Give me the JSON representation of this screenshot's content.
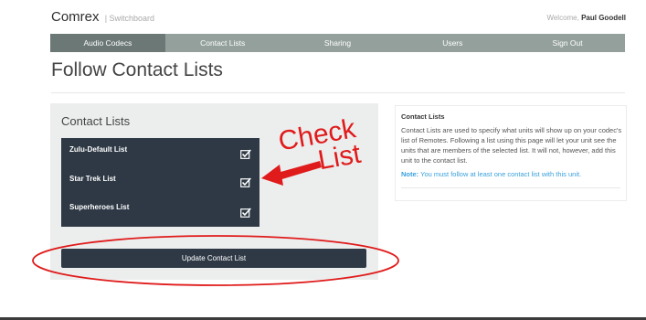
{
  "header": {
    "brand": "Comrex",
    "brand_sub": "| Switchboard",
    "welcome_prefix": "Welcome,",
    "user_name": "Paul Goodell"
  },
  "nav": {
    "tabs": [
      {
        "label": "Audio Codecs"
      },
      {
        "label": "Contact Lists"
      },
      {
        "label": "Sharing"
      },
      {
        "label": "Users"
      },
      {
        "label": "Sign Out"
      }
    ]
  },
  "page": {
    "title": "Follow Contact Lists"
  },
  "contact_panel": {
    "title": "Contact Lists",
    "items": [
      {
        "label": "Zulu-Default List",
        "checked": true
      },
      {
        "label": "Star Trek List",
        "checked": true
      },
      {
        "label": "Superheroes List",
        "checked": true
      }
    ],
    "update_button": "Update Contact List"
  },
  "info": {
    "title": "Contact Lists",
    "body": "Contact Lists are used to specify what units will show up on your codec's list of Remotes. Following a list using this page will let your unit see the units that are members of the selected list. It will not, however, add this unit to the contact list.",
    "note_label": "Note:",
    "note_text": "You must follow at least one contact list with this unit."
  },
  "annotation": {
    "line1": "Check",
    "line2": "List",
    "color": "#e01b1b"
  },
  "colors": {
    "navbar": "#93a09c",
    "navbar_active": "#6b7875",
    "dark_panel": "#2e3945",
    "link_blue": "#3aa0dc"
  }
}
